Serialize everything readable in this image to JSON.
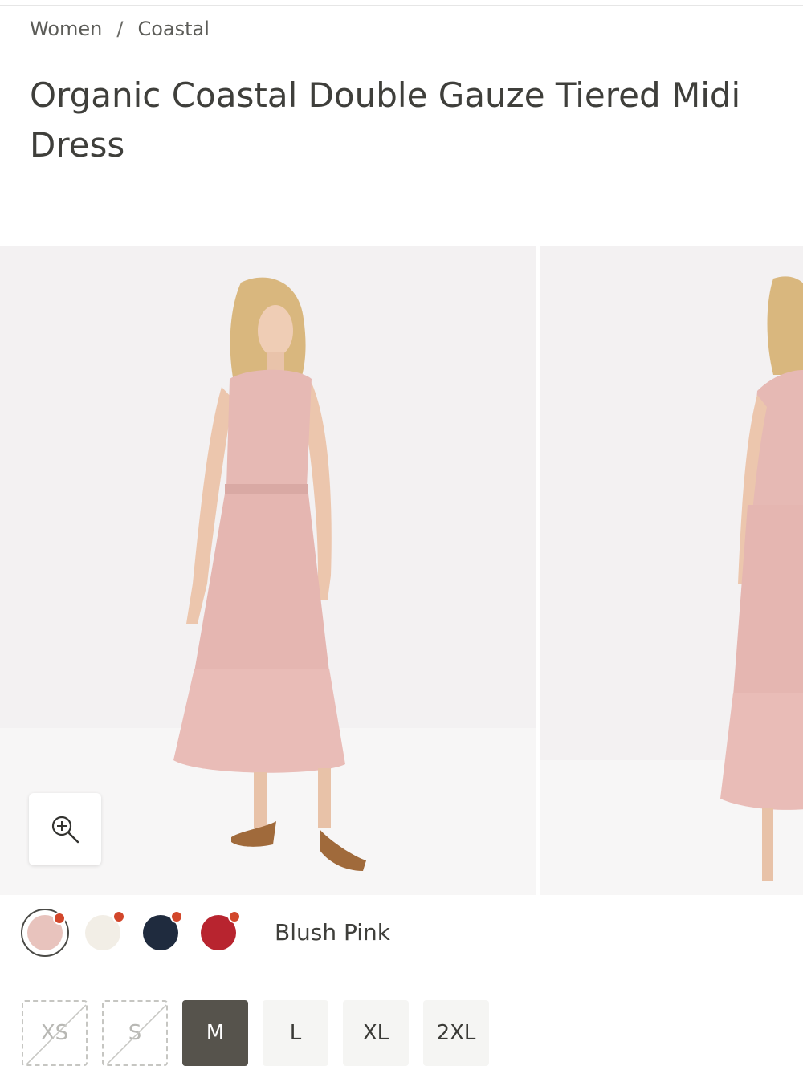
{
  "breadcrumb": {
    "items": [
      "Women",
      "Coastal"
    ],
    "separator": "/"
  },
  "product": {
    "title": "Organic Coastal Double Gauze Tiered Midi Dress"
  },
  "gallery": {
    "zoom_icon": "zoom-in-icon"
  },
  "colors": {
    "selected_name": "Blush Pink",
    "swatches": [
      {
        "hex": "#e8c3bd",
        "selected": true
      },
      {
        "hex": "#f2eee6",
        "selected": false
      },
      {
        "hex": "#1f2b3e",
        "selected": false
      },
      {
        "hex": "#b8242f",
        "selected": false
      }
    ],
    "badge_color": "#d2472b"
  },
  "sizes": {
    "options": [
      {
        "label": "XS",
        "available": false
      },
      {
        "label": "S",
        "available": false
      },
      {
        "label": "M",
        "selected": true
      },
      {
        "label": "L"
      },
      {
        "label": "XL"
      },
      {
        "label": "2XL"
      }
    ]
  }
}
